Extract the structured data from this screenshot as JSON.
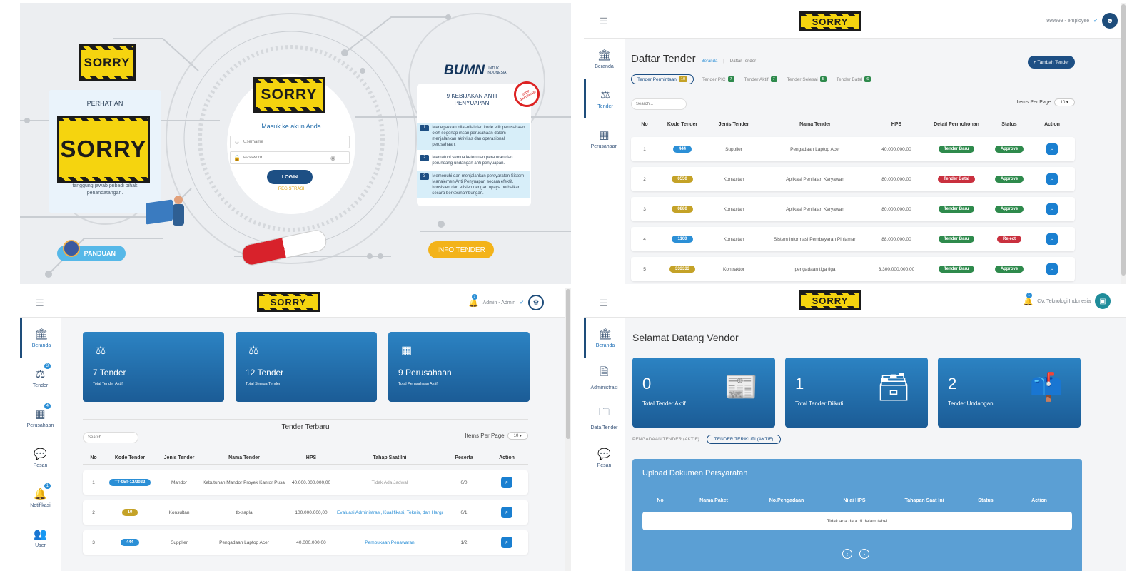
{
  "login": {
    "sorry_text": "SORRY",
    "perhatian_title": "PERHATIAN",
    "perhatian_text": "tanggung jawab pribadi pihak penandatangan.",
    "form_title": "Masuk ke akun Anda",
    "username_placeholder": "Username",
    "password_placeholder": "Password",
    "login_button": "LOGIN",
    "register_link": "REGISTRASI",
    "bumn_logo": "BUMN",
    "bumn_sub": "UNTUK INDONESIA",
    "policy_title": "9 KEBIJAKAN ANTI PENYUAPAN",
    "stamp_text": "STOP GRATIFIKASI",
    "policies": [
      {
        "num": "1",
        "text": "Menegakkan nilai-nilai dan kode etik perusahaan oleh segenap insan perusahaan dalam menjalankan aktivitas dan operasional perusahaan."
      },
      {
        "num": "2",
        "text": "Mematuhi semua ketentuan peraturan dan perundang-undangan anti penyuapan."
      },
      {
        "num": "3",
        "text": "Memenuhi dan menjalankan persyaratan Sistem Manajemen Anti Penyuapan secara efektif, konsisten dan efisien dengan upaya perbaikan secara berkesinambungan."
      }
    ],
    "panduan_button": "PANDUAN",
    "info_button": "INFO TENDER"
  },
  "tender": {
    "logo": "SORRY",
    "user": "999999 - employee",
    "sidebar": [
      {
        "label": "Beranda",
        "icon": "building-icon"
      },
      {
        "label": "Tender",
        "icon": "scale-icon"
      },
      {
        "label": "Perusahaan",
        "icon": "office-icon"
      }
    ],
    "title": "Daftar Tender",
    "breadcrumb_home": "Beranda",
    "breadcrumb_sep": "|",
    "breadcrumb_current": "Daftar Tender",
    "add_button": "+ Tambah Tender",
    "tabs": [
      {
        "label": "Tender Permintaan",
        "count": "10"
      },
      {
        "label": "Tender PIC",
        "count": "7"
      },
      {
        "label": "Tender Aktif",
        "count": "7"
      },
      {
        "label": "Tender Selesai",
        "count": "5"
      },
      {
        "label": "Tender Batal",
        "count": "6"
      }
    ],
    "search_placeholder": "Search...",
    "items_per_page_label": "Items Per Page",
    "items_per_page": "10",
    "columns": [
      "No",
      "Kode Tender",
      "Jenis Tender",
      "Nama Tender",
      "HPS",
      "Detail Permohonan",
      "Status",
      "Action"
    ],
    "rows": [
      {
        "no": "1",
        "kode": "444",
        "jenis": "Supplier",
        "nama": "Pengadaan Laptop Acer",
        "hps": "40.000.000,00",
        "detail": "Tender Baru",
        "status": "Approve"
      },
      {
        "no": "2",
        "kode": "0550",
        "jenis": "Konsultan",
        "nama": "Aplikasi Penilaian Karyawan",
        "hps": "80.000.000,00",
        "detail": "Tender Batal",
        "status": "Approve"
      },
      {
        "no": "3",
        "kode": "0880",
        "jenis": "Konsultan",
        "nama": "Aplikasi Penilaian Karyawan",
        "hps": "80.000.000,00",
        "detail": "Tender Baru",
        "status": "Approve"
      },
      {
        "no": "4",
        "kode": "1100",
        "jenis": "Konsultan",
        "nama": "Sistem Informasi Pembayaran Pinjaman",
        "hps": "88.000.000,00",
        "detail": "Tender Baru",
        "status": "Reject"
      },
      {
        "no": "5",
        "kode": "333333",
        "jenis": "Kontraktor",
        "nama": "pengadaan tiga tiga",
        "hps": "3.300.000.000,00",
        "detail": "Tender Baru",
        "status": "Approve"
      }
    ]
  },
  "admin": {
    "logo": "SORRY",
    "user": "Admin - Admin",
    "bell_count": "1",
    "sidebar": [
      {
        "label": "Beranda",
        "icon": "building-icon",
        "badge": ""
      },
      {
        "label": "Tender",
        "icon": "scale-icon",
        "badge": "3"
      },
      {
        "label": "Perusahaan",
        "icon": "office-icon",
        "badge": "4"
      },
      {
        "label": "Pesan",
        "icon": "chat-icon",
        "badge": ""
      },
      {
        "label": "Notifikasi",
        "icon": "bell-icon",
        "badge": "1"
      },
      {
        "label": "User",
        "icon": "users-icon",
        "badge": ""
      }
    ],
    "cards": [
      {
        "value": "7 Tender",
        "label": "Total Tender Aktif",
        "icon": "scale-icon"
      },
      {
        "value": "12 Tender",
        "label": "Total Semua Tender",
        "icon": "scale-icon"
      },
      {
        "value": "9 Perusahaan",
        "label": "Total Perusahaan Aktif",
        "icon": "office-icon"
      }
    ],
    "section_title": "Tender Terbaru",
    "search_placeholder": "Search...",
    "items_per_page_label": "Items Per Page",
    "items_per_page": "10",
    "columns": [
      "No",
      "Kode Tender",
      "Jenis Tender",
      "Nama Tender",
      "HPS",
      "Tahap Saat Ini",
      "Peserta",
      "Action"
    ],
    "rows": [
      {
        "no": "1",
        "kode": "TT-05T-12/2022",
        "jenis": "Mandor",
        "nama": "Kebutuhan Mandor Proyek Kantor Pusat",
        "hps": "40.000.000.000,00",
        "tahap": "Tidak Ada Jadwal",
        "peserta": "0/0"
      },
      {
        "no": "2",
        "kode": "10",
        "jenis": "Konsultan",
        "nama": "tb-sapla",
        "hps": "100.000.000,00",
        "tahap": "Evaluasi Administrasi, Kualifikasi, Teknis, dan Harga",
        "peserta": "0/1"
      },
      {
        "no": "3",
        "kode": "444",
        "jenis": "Supplier",
        "nama": "Pengadaan Laptop Acer",
        "hps": "40.000.000,00",
        "tahap": "Pembukaan Penawaran",
        "peserta": "1/2"
      }
    ]
  },
  "vendor": {
    "logo": "SORRY",
    "user": "CV. Teknologi Indonesia",
    "bell_count": "1",
    "sidebar": [
      {
        "label": "Beranda",
        "icon": "building-icon"
      },
      {
        "label": "Administrasi",
        "icon": "document-icon"
      },
      {
        "label": "Data Tender",
        "icon": "folder-icon"
      },
      {
        "label": "Pesan",
        "icon": "chat-icon"
      }
    ],
    "title": "Selamat Datang Vendor",
    "cards": [
      {
        "value": "0",
        "label": "Total Tender Aktif",
        "icon": "newspaper-icon"
      },
      {
        "value": "1",
        "label": "Total Tender Diikuti",
        "icon": "archive-icon"
      },
      {
        "value": "2",
        "label": "Tender Undangan",
        "icon": "mailbox-icon"
      }
    ],
    "tabs": [
      "PENGADAAN TENDER (AKTIF)",
      "TENDER TERIKUTI (AKTIF)"
    ],
    "upload_title": "Upload Dokumen Persyaratan",
    "columns": [
      "No",
      "Nama Paket",
      "No.Pengadaan",
      "Nilai HPS",
      "Tahapan Saat Ini",
      "Status",
      "Action"
    ],
    "empty_text": "Tidak ada data di dalam tabel"
  }
}
